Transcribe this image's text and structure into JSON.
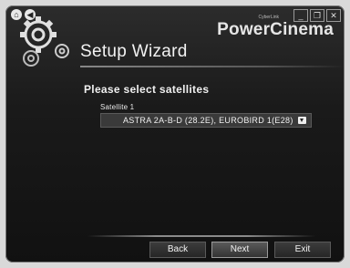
{
  "window": {
    "brand": "PowerCinema",
    "brand_small": "CyberLink",
    "title": "Setup Wizard",
    "controls": {
      "minimize": "_",
      "restore": "❐",
      "close": "✕"
    },
    "sys_icons": {
      "home": "⌂",
      "back": "◀"
    }
  },
  "main": {
    "prompt": "Please select satellites",
    "satellite_label": "Satellite 1",
    "satellite_value": "ASTRA 2A-B-D (28.2E), EUROBIRD 1(E28)"
  },
  "buttons": {
    "back": "Back",
    "next": "Next",
    "exit": "Exit"
  }
}
